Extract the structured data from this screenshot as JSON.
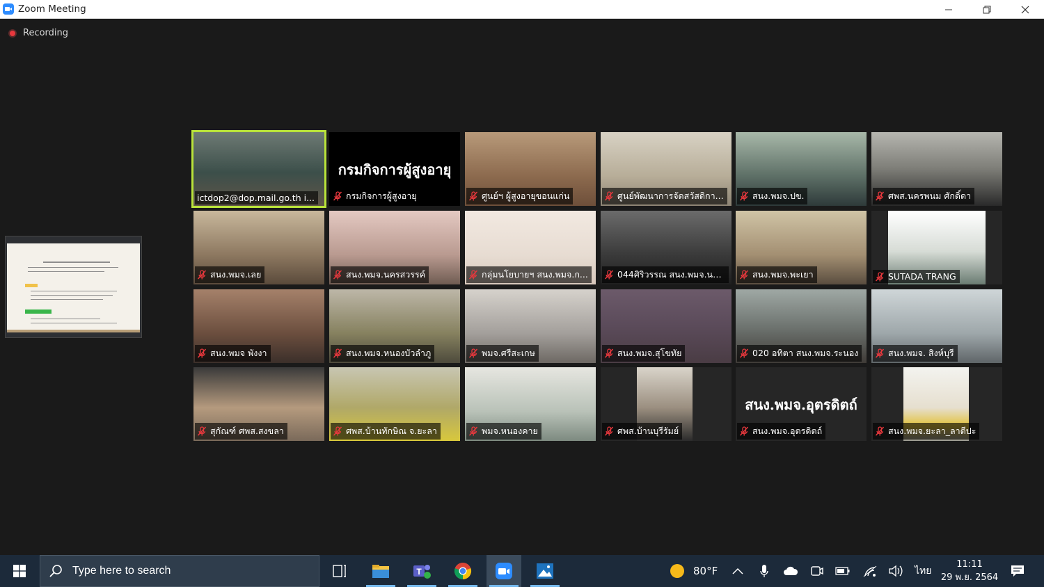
{
  "window": {
    "title": "Zoom Meeting",
    "controls": [
      "minimize",
      "restore",
      "close"
    ]
  },
  "recording": {
    "label": "Recording"
  },
  "shared_screen": {
    "description_icon": "presentation-slide-thumbnail"
  },
  "participants": [
    {
      "name": "ictdop2@dop.mail.go.th i...",
      "active": true,
      "muted": false
    },
    {
      "name": "กรมกิจการผู้สูงอายุ",
      "muted": true,
      "display_text": "กรมกิจการผู้สูงอายุ"
    },
    {
      "name": "ศูนย์ฯ ผู้สูงอายุขอนแก่น",
      "muted": true
    },
    {
      "name": "ศูนย์พัฒนาการจัดสวัสดิกา...",
      "muted": true
    },
    {
      "name": "สนง.พมจ.ปข.",
      "muted": true
    },
    {
      "name": "ศพส.นครพนม ศักดิ์ดา",
      "muted": true
    },
    {
      "name": "สนง.พมจ.เลย",
      "muted": true
    },
    {
      "name": "สนง.พมจ.นครสวรรค์",
      "muted": true
    },
    {
      "name": "กลุ่มนโยบายฯ สนง.พมจ.ก...",
      "muted": true
    },
    {
      "name": "044ศิริวรรณ สนง.พมจ.นค...",
      "muted": true
    },
    {
      "name": "สนง.พมจ.พะเยา",
      "muted": true
    },
    {
      "name": "SUTADA TRANG",
      "muted": true
    },
    {
      "name": "สนง.พมจ พังงา",
      "muted": true
    },
    {
      "name": "สนง.พมจ.หนองบัวลำภู",
      "muted": true
    },
    {
      "name": "พมจ.ศรีสะเกษ",
      "muted": true
    },
    {
      "name": "สนง.พมจ.สุโขทัย",
      "muted": true
    },
    {
      "name": "020 อทิตา สนง.พมจ.ระนอง",
      "muted": true
    },
    {
      "name": "สนง.พมจ. สิงห์บุรี",
      "muted": true
    },
    {
      "name": "สุกัณฑ์ ศพส.สงขลา",
      "muted": true
    },
    {
      "name": "ศพส.บ้านทักษิณ จ.ยะลา",
      "muted": true
    },
    {
      "name": "พมจ.หนองคาย",
      "muted": true
    },
    {
      "name": "ศพส.บ้านบุรีรัมย์",
      "muted": true
    },
    {
      "name": "สนง.พมจ.อุตรดิตถ์",
      "muted": true,
      "display_text": "สนง.พมจ.อุตรดิตถ์"
    },
    {
      "name": "สนง.พมจ.ยะลา_ลาตีปะ",
      "muted": true
    }
  ],
  "taskbar": {
    "search_placeholder": "Type here to search",
    "apps": [
      "task-view",
      "file-explorer",
      "teams",
      "chrome",
      "zoom",
      "photos"
    ],
    "weather": "80°F",
    "language": "ไทย",
    "time": "11:11",
    "date": "29 พ.ย. 2564"
  },
  "colors": {
    "meeting_bg": "#1a1a1a",
    "active_speaker": "#b9e33a",
    "taskbar": "#1c2a3a",
    "muted_red": "#e8383d"
  }
}
